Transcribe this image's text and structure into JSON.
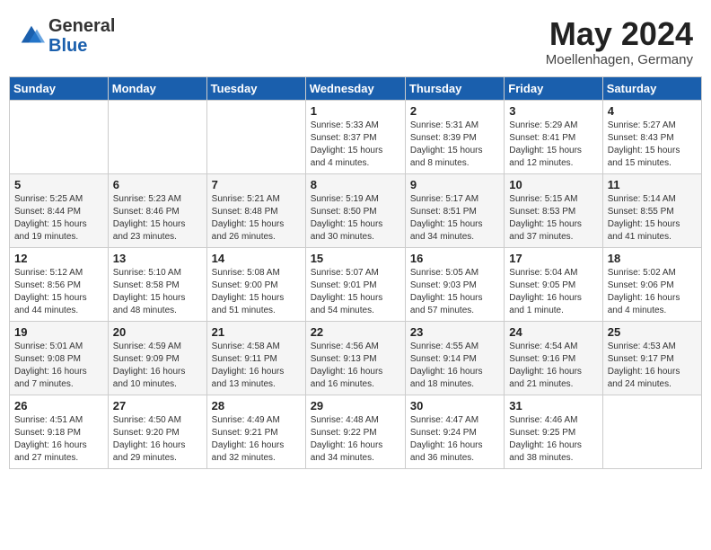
{
  "header": {
    "logo_general": "General",
    "logo_blue": "Blue",
    "month_title": "May 2024",
    "subtitle": "Moellenhagen, Germany"
  },
  "days_of_week": [
    "Sunday",
    "Monday",
    "Tuesday",
    "Wednesday",
    "Thursday",
    "Friday",
    "Saturday"
  ],
  "weeks": [
    [
      {
        "day": "",
        "info": ""
      },
      {
        "day": "",
        "info": ""
      },
      {
        "day": "",
        "info": ""
      },
      {
        "day": "1",
        "info": "Sunrise: 5:33 AM\nSunset: 8:37 PM\nDaylight: 15 hours\nand 4 minutes."
      },
      {
        "day": "2",
        "info": "Sunrise: 5:31 AM\nSunset: 8:39 PM\nDaylight: 15 hours\nand 8 minutes."
      },
      {
        "day": "3",
        "info": "Sunrise: 5:29 AM\nSunset: 8:41 PM\nDaylight: 15 hours\nand 12 minutes."
      },
      {
        "day": "4",
        "info": "Sunrise: 5:27 AM\nSunset: 8:43 PM\nDaylight: 15 hours\nand 15 minutes."
      }
    ],
    [
      {
        "day": "5",
        "info": "Sunrise: 5:25 AM\nSunset: 8:44 PM\nDaylight: 15 hours\nand 19 minutes."
      },
      {
        "day": "6",
        "info": "Sunrise: 5:23 AM\nSunset: 8:46 PM\nDaylight: 15 hours\nand 23 minutes."
      },
      {
        "day": "7",
        "info": "Sunrise: 5:21 AM\nSunset: 8:48 PM\nDaylight: 15 hours\nand 26 minutes."
      },
      {
        "day": "8",
        "info": "Sunrise: 5:19 AM\nSunset: 8:50 PM\nDaylight: 15 hours\nand 30 minutes."
      },
      {
        "day": "9",
        "info": "Sunrise: 5:17 AM\nSunset: 8:51 PM\nDaylight: 15 hours\nand 34 minutes."
      },
      {
        "day": "10",
        "info": "Sunrise: 5:15 AM\nSunset: 8:53 PM\nDaylight: 15 hours\nand 37 minutes."
      },
      {
        "day": "11",
        "info": "Sunrise: 5:14 AM\nSunset: 8:55 PM\nDaylight: 15 hours\nand 41 minutes."
      }
    ],
    [
      {
        "day": "12",
        "info": "Sunrise: 5:12 AM\nSunset: 8:56 PM\nDaylight: 15 hours\nand 44 minutes."
      },
      {
        "day": "13",
        "info": "Sunrise: 5:10 AM\nSunset: 8:58 PM\nDaylight: 15 hours\nand 48 minutes."
      },
      {
        "day": "14",
        "info": "Sunrise: 5:08 AM\nSunset: 9:00 PM\nDaylight: 15 hours\nand 51 minutes."
      },
      {
        "day": "15",
        "info": "Sunrise: 5:07 AM\nSunset: 9:01 PM\nDaylight: 15 hours\nand 54 minutes."
      },
      {
        "day": "16",
        "info": "Sunrise: 5:05 AM\nSunset: 9:03 PM\nDaylight: 15 hours\nand 57 minutes."
      },
      {
        "day": "17",
        "info": "Sunrise: 5:04 AM\nSunset: 9:05 PM\nDaylight: 16 hours\nand 1 minute."
      },
      {
        "day": "18",
        "info": "Sunrise: 5:02 AM\nSunset: 9:06 PM\nDaylight: 16 hours\nand 4 minutes."
      }
    ],
    [
      {
        "day": "19",
        "info": "Sunrise: 5:01 AM\nSunset: 9:08 PM\nDaylight: 16 hours\nand 7 minutes."
      },
      {
        "day": "20",
        "info": "Sunrise: 4:59 AM\nSunset: 9:09 PM\nDaylight: 16 hours\nand 10 minutes."
      },
      {
        "day": "21",
        "info": "Sunrise: 4:58 AM\nSunset: 9:11 PM\nDaylight: 16 hours\nand 13 minutes."
      },
      {
        "day": "22",
        "info": "Sunrise: 4:56 AM\nSunset: 9:13 PM\nDaylight: 16 hours\nand 16 minutes."
      },
      {
        "day": "23",
        "info": "Sunrise: 4:55 AM\nSunset: 9:14 PM\nDaylight: 16 hours\nand 18 minutes."
      },
      {
        "day": "24",
        "info": "Sunrise: 4:54 AM\nSunset: 9:16 PM\nDaylight: 16 hours\nand 21 minutes."
      },
      {
        "day": "25",
        "info": "Sunrise: 4:53 AM\nSunset: 9:17 PM\nDaylight: 16 hours\nand 24 minutes."
      }
    ],
    [
      {
        "day": "26",
        "info": "Sunrise: 4:51 AM\nSunset: 9:18 PM\nDaylight: 16 hours\nand 27 minutes."
      },
      {
        "day": "27",
        "info": "Sunrise: 4:50 AM\nSunset: 9:20 PM\nDaylight: 16 hours\nand 29 minutes."
      },
      {
        "day": "28",
        "info": "Sunrise: 4:49 AM\nSunset: 9:21 PM\nDaylight: 16 hours\nand 32 minutes."
      },
      {
        "day": "29",
        "info": "Sunrise: 4:48 AM\nSunset: 9:22 PM\nDaylight: 16 hours\nand 34 minutes."
      },
      {
        "day": "30",
        "info": "Sunrise: 4:47 AM\nSunset: 9:24 PM\nDaylight: 16 hours\nand 36 minutes."
      },
      {
        "day": "31",
        "info": "Sunrise: 4:46 AM\nSunset: 9:25 PM\nDaylight: 16 hours\nand 38 minutes."
      },
      {
        "day": "",
        "info": ""
      }
    ]
  ]
}
